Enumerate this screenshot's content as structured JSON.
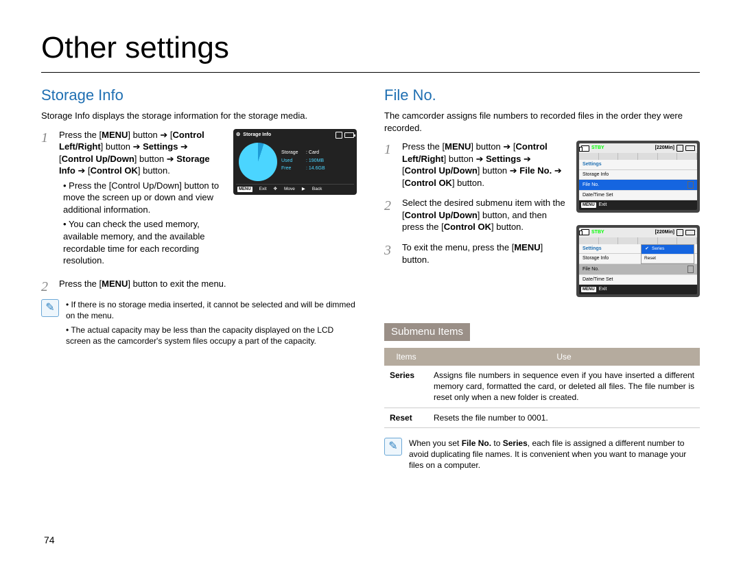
{
  "page_title": "Other settings",
  "page_number": "74",
  "left": {
    "heading": "Storage Info",
    "intro": "Storage Info displays the storage information for the storage media.",
    "step1": {
      "parts": {
        "a": "Press the [",
        "b": "MENU",
        "c": "] button ➔ [",
        "d": "Control Left/Right",
        "e": "] button ➔ ",
        "f": "Settings",
        "g": " ➔ [",
        "h": "Control Up/Down",
        "i": "] button ➔ ",
        "j": "Storage Info",
        "k": " ➔ [",
        "l": "Control OK",
        "m": "] button."
      },
      "bullets": [
        "Press the [Control Up/Down] button to move the screen up or down and view additional information.",
        "You can check the used memory, available memory, and the available recordable time for each recording resolution."
      ]
    },
    "step2": {
      "a": "Press the [",
      "b": "MENU",
      "c": "] button to exit the menu."
    },
    "notes": [
      "If there is no storage media inserted, it cannot be selected and will be dimmed on the menu.",
      "The actual capacity may be less than the capacity displayed on the LCD screen as the camcorder's system files occupy a part of the capacity."
    ],
    "lcd": {
      "title": "Storage Info",
      "storage_lbl": "Storage",
      "storage_val": ": Card",
      "used_lbl": "Used",
      "used_val": ": 190MB",
      "free_lbl": "Free",
      "free_val": ": 14.6GB",
      "menu_tag": "MENU",
      "exit": "Exit",
      "move": "Move",
      "back": "Back"
    }
  },
  "right": {
    "heading": "File No.",
    "intro": "The camcorder assigns file numbers to recorded files in the order they were recorded.",
    "step1": {
      "a": "Press the [",
      "b": "MENU",
      "c": "] button ➔ [",
      "d": "Control Left/Right",
      "e": "] button ➔ ",
      "f": "Settings",
      "g": " ➔ [",
      "h": "Control Up/Down",
      "i": "] button ➔ ",
      "j": "File No.",
      "k": " ➔ [",
      "l": "Control OK",
      "m": "] button."
    },
    "step2": {
      "a": "Select the desired submenu item with the [",
      "b": "Control Up/Down",
      "c": "] button, and then press the [",
      "d": "Control OK",
      "e": "] button."
    },
    "step3": {
      "a": "To exit the menu, press the [",
      "b": "MENU",
      "c": "] button."
    },
    "lcd_common": {
      "stby": "STBY",
      "time": "[220Min]",
      "settings": "Settings",
      "storage_info": "Storage Info",
      "file_no": "File No.",
      "date_time": "Date/Time Set",
      "reset": "Reset",
      "series": "Series",
      "menu_tag": "MENU",
      "exit": "Exit"
    },
    "submenu_heading": "Submenu Items",
    "table": {
      "col_items": "Items",
      "col_use": "Use",
      "rows": [
        {
          "item": "Series",
          "use": "Assigns file numbers in sequence even if you have inserted a different memory card, formatted the card, or deleted all files. The file number is reset only when a new folder is created."
        },
        {
          "item": "Reset",
          "use": "Resets the file number to 0001."
        }
      ]
    },
    "note": {
      "a": "When you set ",
      "b": "File No.",
      "c": " to ",
      "d": "Series",
      "e": ", each file is assigned a different number to avoid duplicating file names. It is convenient when you want to manage your files on a computer."
    }
  }
}
